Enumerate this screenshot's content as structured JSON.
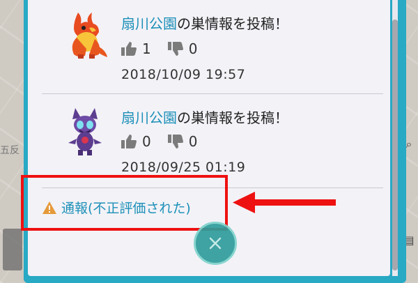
{
  "map": {
    "label_fragment": "五反"
  },
  "posts": [
    {
      "park_name": "扇川公園",
      "action_text": "の巣情報を投稿！",
      "likes": "1",
      "dislikes": "0",
      "date": "2018/10/09 19:57",
      "sprite_icon": "magmar-sprite-icon"
    },
    {
      "park_name": "扇川公園",
      "action_text": "の巣情報を投稿！",
      "likes": "0",
      "dislikes": "0",
      "date": "2018/09/25 01:19",
      "sprite_icon": "sableye-sprite-icon"
    }
  ],
  "report": {
    "label": "通報(不正評価された)",
    "icon": "warning-icon"
  },
  "colors": {
    "accent": "#1d90b8",
    "frame": "#28a9c4",
    "highlight": "#ee1111",
    "close_button": "#2f9d9b"
  }
}
